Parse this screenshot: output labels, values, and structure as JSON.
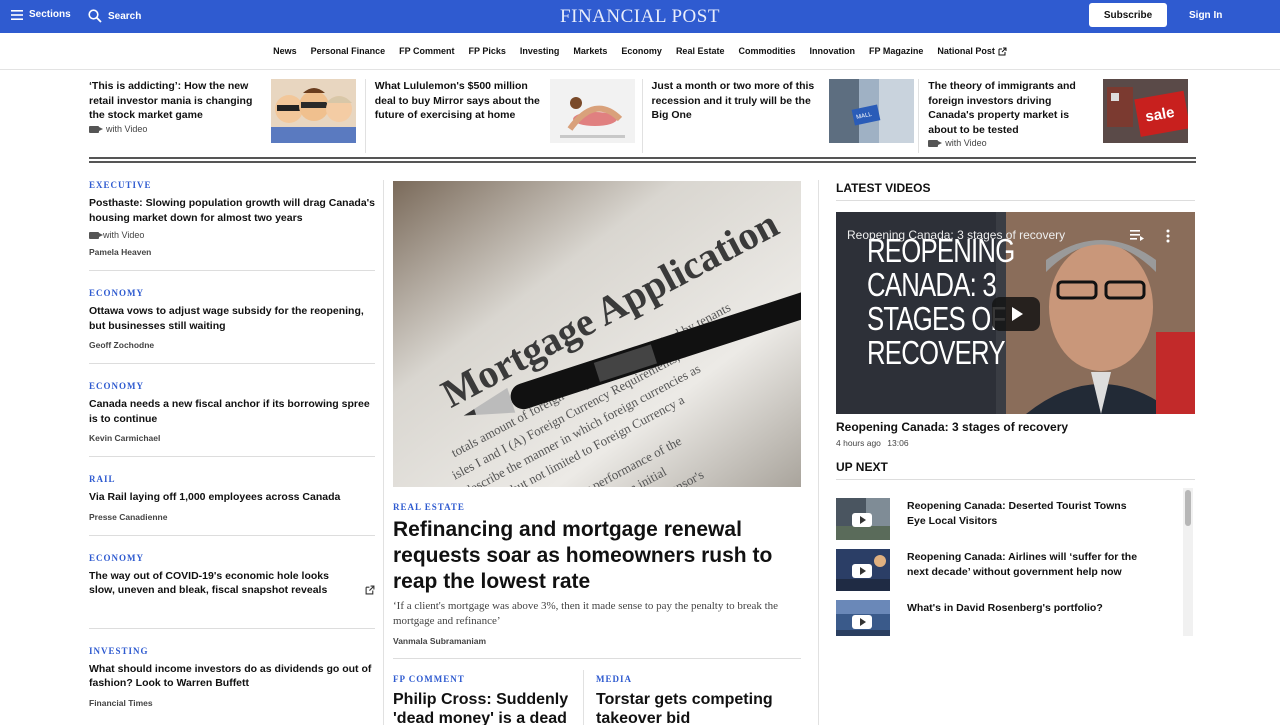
{
  "header": {
    "sections_label": "Sections",
    "search_label": "Search",
    "brand": "FINANCIAL POST",
    "subscribe_label": "Subscribe",
    "signin_label": "Sign In",
    "accent_color": "#2f5bd0"
  },
  "nav": {
    "items": [
      "News",
      "Personal Finance",
      "FP Comment",
      "FP Picks",
      "Investing",
      "Markets",
      "Economy",
      "Real Estate",
      "Commodities",
      "Innovation",
      "FP Magazine",
      "National Post"
    ]
  },
  "top_strip": [
    {
      "title": "‘This is addicting’: How the new retail investor mania is changing the stock market game",
      "video": "with Video"
    },
    {
      "title": "What Lululemon's $500 million deal to buy Mirror says about the future of exercising at home",
      "video": ""
    },
    {
      "title": "Just a month or two more of this recession and it truly will be the Big One",
      "video": ""
    },
    {
      "title": "The theory of immigrants and foreign investors driving Canada's property market is about to be tested",
      "video": "with Video"
    }
  ],
  "left_column": [
    {
      "kicker": "EXECUTIVE",
      "title": "Posthaste: Slowing population growth will drag Canada's housing market down for almost two years",
      "video": "with Video",
      "author": "Pamela Heaven"
    },
    {
      "kicker": "ECONOMY",
      "title": "Ottawa vows to adjust wage subsidy for the reopening, but businesses still waiting",
      "video": "",
      "author": "Geoff Zochodne"
    },
    {
      "kicker": "ECONOMY",
      "title": "Canada needs a new fiscal anchor if its borrowing spree is to continue",
      "video": "",
      "author": "Kevin Carmichael"
    },
    {
      "kicker": "RAIL",
      "title": "Via Rail laying off 1,000 employees across Canada",
      "video": "",
      "author": "Presse Canadienne"
    },
    {
      "kicker": "ECONOMY",
      "title": "The way out of COVID-19's economic hole looks slow, uneven and bleak, fiscal snapshot reveals",
      "video": "",
      "author": ""
    },
    {
      "kicker": "INVESTING",
      "title": "What should income investors do as dividends go out of fashion? Look to Warren Buffett",
      "video": "",
      "author": "Financial Times"
    }
  ],
  "center": {
    "hero_image_text": "Mortgage Application",
    "kicker": "REAL ESTATE",
    "title": "Refinancing and mortgage renewal requests soar as homeowners rush to reap the lowest rate",
    "deck": "‘If a client's mortgage was above 3%, then it made sense to pay the penalty to break the mortgage and refinance’",
    "author": "Vanmala Subramaniam",
    "sub_stories": [
      {
        "kicker": "FP COMMENT",
        "title": "Philip Cross: Suddenly 'dead money' is a dead"
      },
      {
        "kicker": "MEDIA",
        "title": "Torstar gets competing takeover bid"
      }
    ]
  },
  "right_column": {
    "latest_videos_label": "LATEST VIDEOS",
    "player_title": "Reopening Canada: 3 stages of recovery",
    "player_overlay": "REOPENING CANADA: 3 STAGES OF RECOVERY",
    "caption": "Reopening Canada: 3 stages of recovery",
    "time_ago": "4 hours ago",
    "duration": "13:06",
    "up_next_label": "UP NEXT",
    "up_next": [
      {
        "title": "Reopening Canada: Deserted Tourist Towns Eye Local Visitors"
      },
      {
        "title": "Reopening Canada: Airlines will ‘suffer for the next decade’ without government help now"
      },
      {
        "title": "What's in David Rosenberg's portfolio?"
      }
    ]
  }
}
